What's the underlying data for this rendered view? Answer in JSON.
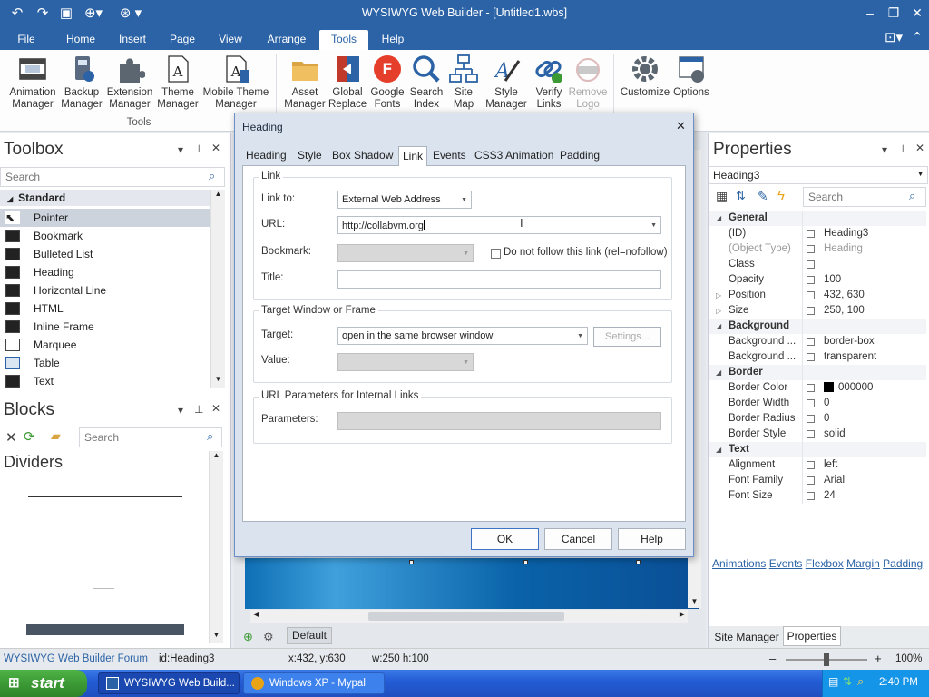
{
  "window": {
    "title": "WYSIWYG Web Builder - [Untitled1.wbs]"
  },
  "menu": {
    "tabs": [
      "File",
      "Home",
      "Insert",
      "Page",
      "View",
      "Arrange",
      "Tools",
      "Help"
    ],
    "active": "Tools"
  },
  "ribbon": {
    "group_label": "Tools",
    "buttons": [
      {
        "label1": "Animation",
        "label2": "Manager",
        "icon": "film-icon"
      },
      {
        "label1": "Backup",
        "label2": "Manager",
        "icon": "backup-icon"
      },
      {
        "label1": "Extension",
        "label2": "Manager",
        "icon": "puzzle-icon"
      },
      {
        "label1": "Theme",
        "label2": "Manager",
        "icon": "theme-doc-icon"
      },
      {
        "label1": "Mobile Theme",
        "label2": "Manager",
        "icon": "mobile-doc-icon"
      },
      {
        "label1": "Asset",
        "label2": "Manager",
        "icon": "folder-icon"
      },
      {
        "label1": "Global",
        "label2": "Replace",
        "icon": "replace-icon"
      },
      {
        "label1": "Google",
        "label2": "Fonts",
        "icon": "google-fonts-icon",
        "glyph": "F"
      },
      {
        "label1": "Search",
        "label2": "Index",
        "icon": "search-index-icon"
      },
      {
        "label1": "Site",
        "label2": "Map",
        "icon": "sitemap-icon"
      },
      {
        "label1": "Style",
        "label2": "Manager",
        "icon": "style-icon"
      },
      {
        "label1": "Verify",
        "label2": "Links",
        "icon": "verify-links-icon"
      },
      {
        "label1": "Remove",
        "label2": "Logo",
        "icon": "remove-logo-icon",
        "disabled": true
      },
      {
        "label1": "Customize",
        "label2": "",
        "icon": "gear-icon"
      },
      {
        "label1": "Options",
        "label2": "",
        "icon": "options-icon"
      }
    ]
  },
  "toolbox": {
    "title": "Toolbox",
    "search_placeholder": "Search",
    "category": "Standard",
    "items": [
      "Pointer",
      "Bookmark",
      "Bulleted List",
      "Heading",
      "Horizontal Line",
      "HTML",
      "Inline Frame",
      "Marquee",
      "Table",
      "Text"
    ]
  },
  "blocks": {
    "title": "Blocks",
    "search_placeholder": "Search",
    "category": "Dividers"
  },
  "dialog": {
    "title": "Heading",
    "tabs": [
      "Heading",
      "Style",
      "Box Shadow",
      "Link",
      "Events",
      "CSS3 Animation",
      "Padding"
    ],
    "active_tab": "Link",
    "link_group": "Link",
    "link_to_label": "Link to:",
    "link_to_value": "External Web Address",
    "url_label": "URL:",
    "url_value": "http://collabvm.org",
    "bookmark_label": "Bookmark:",
    "nofollow_label": "Do not follow this link (rel=nofollow)",
    "title_label": "Title:",
    "target_group": "Target Window or Frame",
    "target_label": "Target:",
    "target_value": "open in the same browser window",
    "settings_button": "Settings...",
    "value_label": "Value:",
    "params_group": "URL Parameters for Internal Links",
    "params_label": "Parameters:",
    "ok": "OK",
    "cancel": "Cancel",
    "help": "Help"
  },
  "properties": {
    "title": "Properties",
    "object": "Heading3",
    "search_placeholder": "Search",
    "rows": [
      {
        "type": "cat",
        "name": "General"
      },
      {
        "type": "prop",
        "name": "(ID)",
        "value": "Heading3"
      },
      {
        "type": "prop",
        "name": "(Object Type)",
        "value": "Heading",
        "dim": true
      },
      {
        "type": "prop",
        "name": "Class",
        "value": ""
      },
      {
        "type": "prop",
        "name": "Opacity",
        "value": "100"
      },
      {
        "type": "prop",
        "name": "Position",
        "value": "432, 630",
        "expand": true
      },
      {
        "type": "prop",
        "name": "Size",
        "value": "250, 100",
        "expand": true
      },
      {
        "type": "cat",
        "name": "Background"
      },
      {
        "type": "prop",
        "name": "Background ...",
        "value": "border-box"
      },
      {
        "type": "prop",
        "name": "Background ...",
        "value": "transparent"
      },
      {
        "type": "cat",
        "name": "Border"
      },
      {
        "type": "prop",
        "name": "Border Color",
        "value": "000000",
        "swatch": "#000000"
      },
      {
        "type": "prop",
        "name": "Border Width",
        "value": "0"
      },
      {
        "type": "prop",
        "name": "Border Radius",
        "value": "0"
      },
      {
        "type": "prop",
        "name": "Border Style",
        "value": "solid"
      },
      {
        "type": "cat",
        "name": "Text"
      },
      {
        "type": "prop",
        "name": "Alignment",
        "value": "left"
      },
      {
        "type": "prop",
        "name": "Font Family",
        "value": "Arial"
      },
      {
        "type": "prop",
        "name": "Font Size",
        "value": "24"
      }
    ],
    "links": [
      "Animations",
      "Events",
      "Flexbox",
      "Margin",
      "Padding"
    ],
    "bottom_tabs": [
      "Site Manager",
      "Properties"
    ]
  },
  "canvas": {
    "page_tab": "Default"
  },
  "statusbar": {
    "forum_link": "WYSIWYG Web Builder Forum",
    "id": "id:Heading3",
    "xy": "x:432, y:630",
    "wh": "w:250 h:100",
    "zoom": "100%"
  },
  "taskbar": {
    "start": "start",
    "tasks": [
      "WYSIWYG Web Build...",
      "Windows XP - Mypal"
    ],
    "clock": "2:40 PM"
  },
  "colors": {
    "accent": "#2b63a6",
    "taskbar": "#245dd6",
    "start": "#3c9a35"
  }
}
